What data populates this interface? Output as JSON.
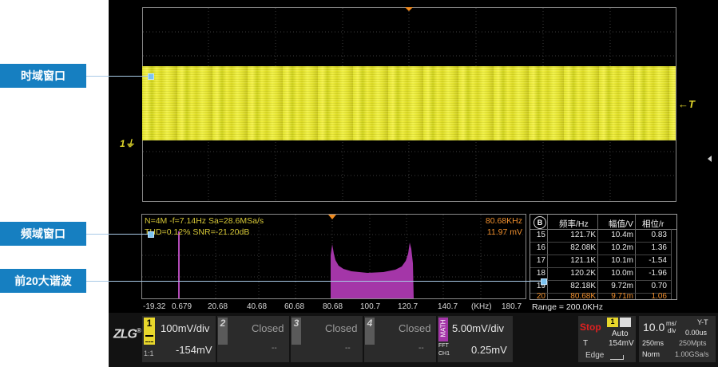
{
  "annotations": {
    "time_window": "时域窗口",
    "freq_window": "频域窗口",
    "harmonics": "前20大谐波"
  },
  "waveform": {
    "channel_marker": "1",
    "trigger_marker": "T"
  },
  "spectrum": {
    "info_line1": "N=4M  -f=7.14Hz  Sa=28.6MSa/s",
    "info_line2": "THD=0.12%  SNR=-21.20dB",
    "cursor_freq": "80.68KHz",
    "cursor_amp": "11.97 mV",
    "x_ticks": [
      "-19.32",
      "0.679",
      "20.68",
      "40.68",
      "60.68",
      "80.68",
      "100.7",
      "120.7",
      "140.7",
      "(KHz)",
      "180.7"
    ]
  },
  "harmonic_table": {
    "badge": "B",
    "headers": [
      "频率/Hz",
      "幅值/V",
      "相位/r"
    ],
    "rows": [
      {
        "n": "15",
        "freq": "121.7K",
        "amp": "10.4m",
        "phase": "0.83"
      },
      {
        "n": "16",
        "freq": "82.08K",
        "amp": "10.2m",
        "phase": "1.36"
      },
      {
        "n": "17",
        "freq": "121.1K",
        "amp": "10.1m",
        "phase": "-1.54"
      },
      {
        "n": "18",
        "freq": "120.2K",
        "amp": "10.0m",
        "phase": "-1.96"
      },
      {
        "n": "19",
        "freq": "82.18K",
        "amp": "9.72m",
        "phase": "0.70"
      },
      {
        "n": "20",
        "freq": "80.68K",
        "amp": "9.71m",
        "phase": "1.06"
      }
    ],
    "range": "Range = 200.0KHz"
  },
  "bottom": {
    "logo": "ZLG",
    "ch1": {
      "num": "1",
      "scale": "100mV/div",
      "offset": "-154mV",
      "coupling": "1:1"
    },
    "ch2": {
      "num": "2",
      "state": "Closed",
      "offset": "--"
    },
    "ch3": {
      "num": "3",
      "state": "Closed",
      "offset": "--"
    },
    "ch4": {
      "num": "4",
      "state": "Closed",
      "offset": "--"
    },
    "math": {
      "label": "MATH",
      "scale": "5.00mV/div",
      "offset": "0.25mV",
      "fft": "FFT",
      "src": "CH1"
    },
    "trigger": {
      "status": "Stop",
      "source": "1",
      "mode": "Auto",
      "type": "T",
      "level": "154mV",
      "edge": "Edge"
    },
    "timebase": {
      "value": "10.0",
      "unit_top": "ms/",
      "unit_bot": "div",
      "mode": "Y-T",
      "delay": "0.00us",
      "len": "250ms",
      "mpts": "250Mpts",
      "acq": "Norm",
      "rate": "1.00GSa/s"
    }
  },
  "colors": {
    "annotation_bg": "#167fc1",
    "waveform": "#e8e82a",
    "spectrum_fill": "#a436a8",
    "stop": "#e02020"
  }
}
